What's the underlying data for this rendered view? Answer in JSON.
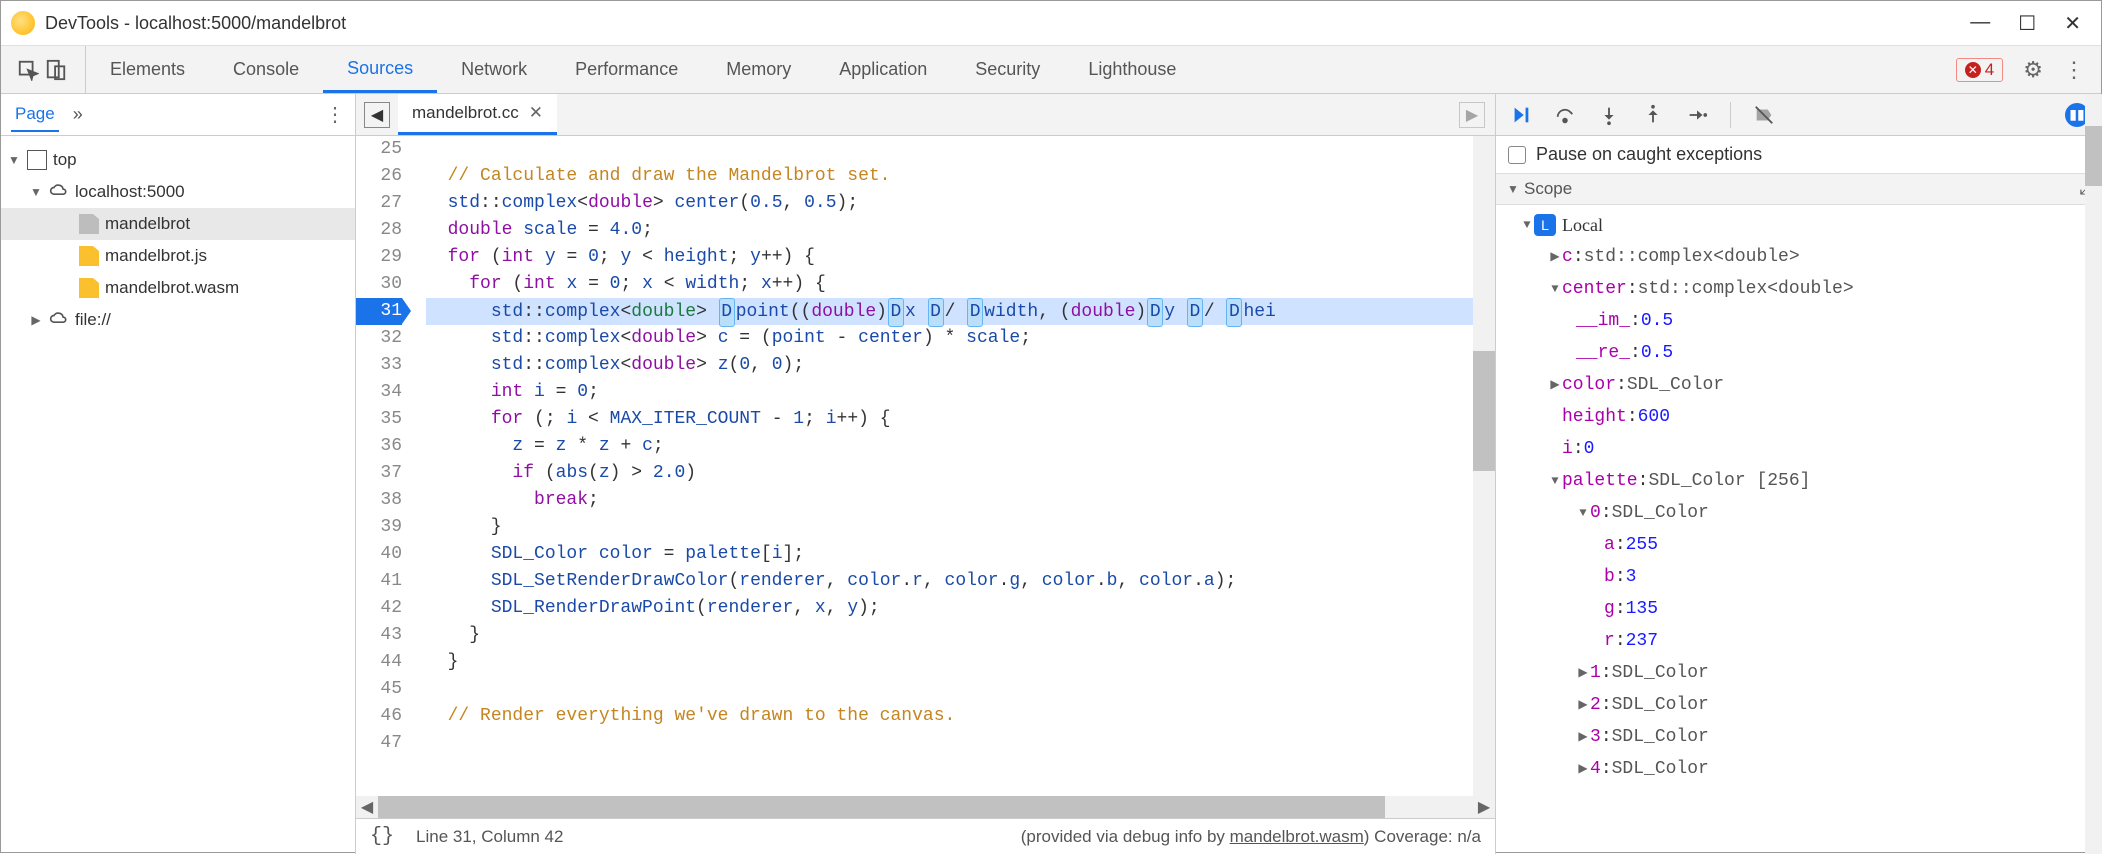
{
  "window": {
    "title": "DevTools - localhost:5000/mandelbrot"
  },
  "tabs": {
    "items": [
      "Elements",
      "Console",
      "Sources",
      "Network",
      "Performance",
      "Memory",
      "Application",
      "Security",
      "Lighthouse"
    ],
    "active": "Sources",
    "error_count": "4"
  },
  "left": {
    "page_label": "Page",
    "tree": {
      "top": "top",
      "host": "localhost:5000",
      "files": [
        "mandelbrot",
        "mandelbrot.js",
        "mandelbrot.wasm"
      ],
      "file_scheme": "file://"
    }
  },
  "editor": {
    "filename": "mandelbrot.cc",
    "first_line": 25,
    "breakpoint_line": 31,
    "lines": [
      "",
      "  // Calculate and draw the Mandelbrot set.",
      "  std::complex<double> center(0.5, 0.5);",
      "  double scale = 4.0;",
      "  for (int y = 0; y < height; y++) {",
      "    for (int x = 0; x < width; x++) {",
      "      std::complex<double> point((double)x / width, (double)y / hei",
      "      std::complex<double> c = (point - center) * scale;",
      "      std::complex<double> z(0, 0);",
      "      int i = 0;",
      "      for (; i < MAX_ITER_COUNT - 1; i++) {",
      "        z = z * z + c;",
      "        if (abs(z) > 2.0)",
      "          break;",
      "      }",
      "      SDL_Color color = palette[i];",
      "      SDL_SetRenderDrawColor(renderer, color.r, color.g, color.b, color.a);",
      "      SDL_RenderDrawPoint(renderer, x, y);",
      "    }",
      "  }",
      "",
      "  // Render everything we've drawn to the canvas.",
      ""
    ]
  },
  "status": {
    "pos": "Line 31, Column 42",
    "info_prefix": "(provided via debug info by ",
    "info_link": "mandelbrot.wasm",
    "info_suffix": ") Coverage: n/a"
  },
  "debug": {
    "pause_label": "Pause on caught exceptions",
    "scope_label": "Scope",
    "local_label": "Local",
    "vars": {
      "c": "std::complex<double>",
      "center": "std::complex<double>",
      "center_im": "0.5",
      "center_re": "0.5",
      "color": "SDL_Color",
      "height": "600",
      "i": "0",
      "palette": "SDL_Color [256]",
      "pal0": "SDL_Color",
      "pal0_a": "255",
      "pal0_b": "3",
      "pal0_g": "135",
      "pal0_r": "237",
      "sdl1": "SDL_Color",
      "sdl2": "SDL_Color",
      "sdl3": "SDL_Color",
      "sdl4": "SDL_Color"
    }
  }
}
